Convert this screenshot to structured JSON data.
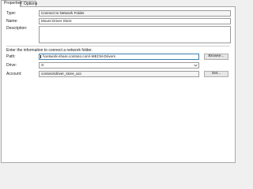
{
  "tabs": [
    {
      "label": "Properties",
      "active": true
    },
    {
      "label": "Options",
      "active": false
    }
  ],
  "form": {
    "type_label": "Type:",
    "type_value": "Connect to Network Folder",
    "name_label": "Name:",
    "name_value": "Mount Driver Store",
    "description_label": "Description:",
    "description_value": "",
    "instruction": "Enter the information to connect a network folder.",
    "path_label": "Path:",
    "path_value": "\\\\network-share.contoso.com\\-MECM-Drivers",
    "browse_label": "Browse...",
    "drive_label": "Drive:",
    "drive_value": "S:",
    "account_label": "Account:",
    "account_value": "contoso\\driver_store_acc",
    "set_label": "Set..."
  },
  "colors": {
    "path_focus_border": "#3c7fb1"
  }
}
